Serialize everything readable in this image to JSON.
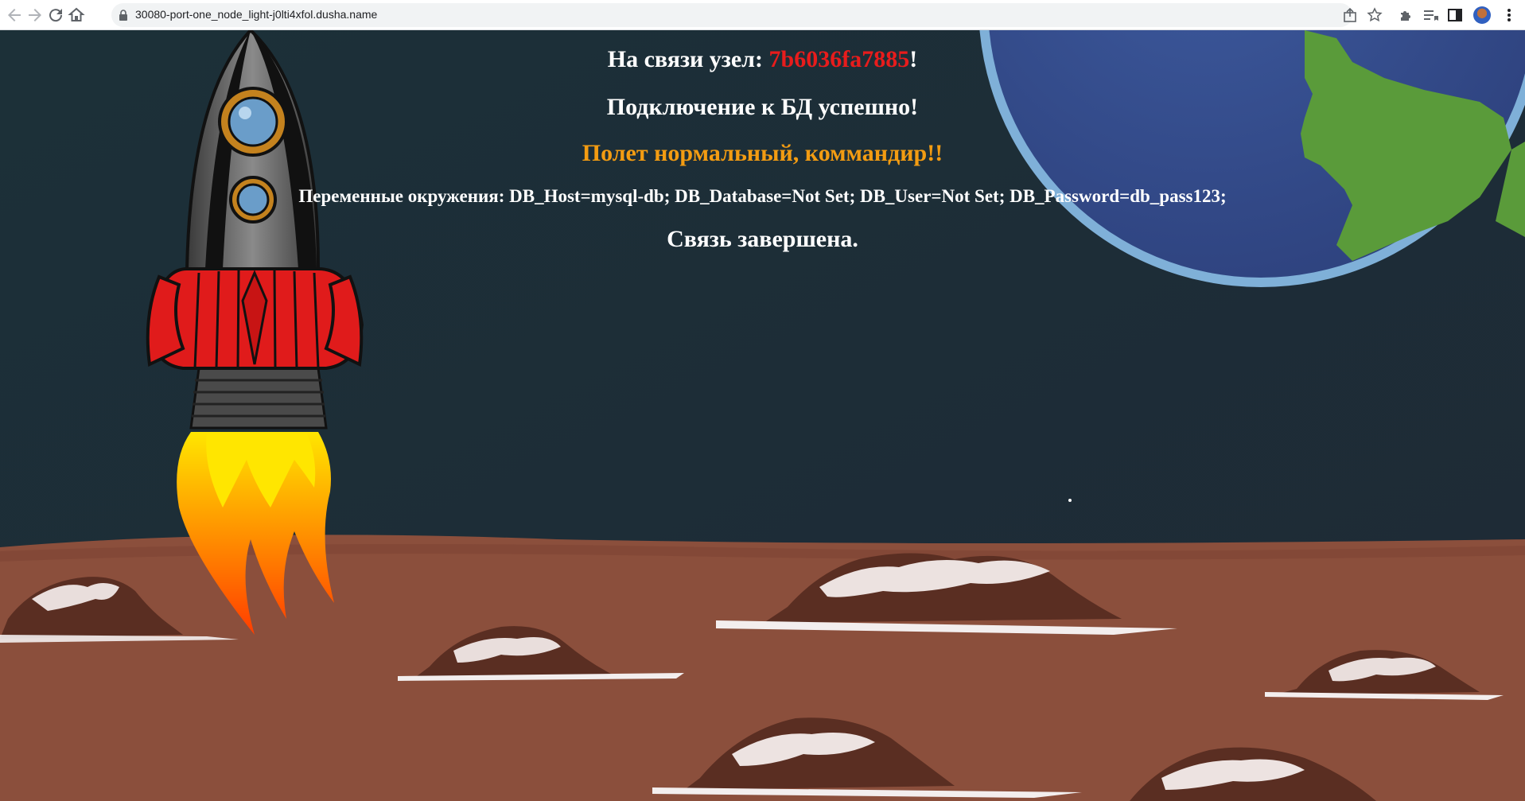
{
  "browser": {
    "url": "30080-port-one_node_light-j0lti4xfol.dusha.name",
    "nav_icons": [
      "back-arrow-icon",
      "forward-arrow-icon",
      "reload-icon",
      "home-icon"
    ],
    "right_icons": [
      "share-icon",
      "bookmark-star-icon",
      "extensions-icon",
      "reading-list-icon",
      "side-panel-icon",
      "profile-avatar",
      "menu-kebab-icon"
    ]
  },
  "page": {
    "node_prefix": "На связи узел: ",
    "node_id": "7b6036fa7885",
    "node_suffix": "!",
    "db_status": "Подключение к БД успешно!",
    "flight_status": "Полет нормальный, коммандир!!",
    "env_vars": "Переменные окружения: DB_Host=mysql-db; DB_Database=Not Set; DB_User=Not Set; DB_Password=db_pass123;",
    "footer": "Связь завершена."
  },
  "colors": {
    "sky": "#1c2c38",
    "ground": "#8a4f3c",
    "node_id": "#e81c1c",
    "flight_status": "#f39c12"
  }
}
